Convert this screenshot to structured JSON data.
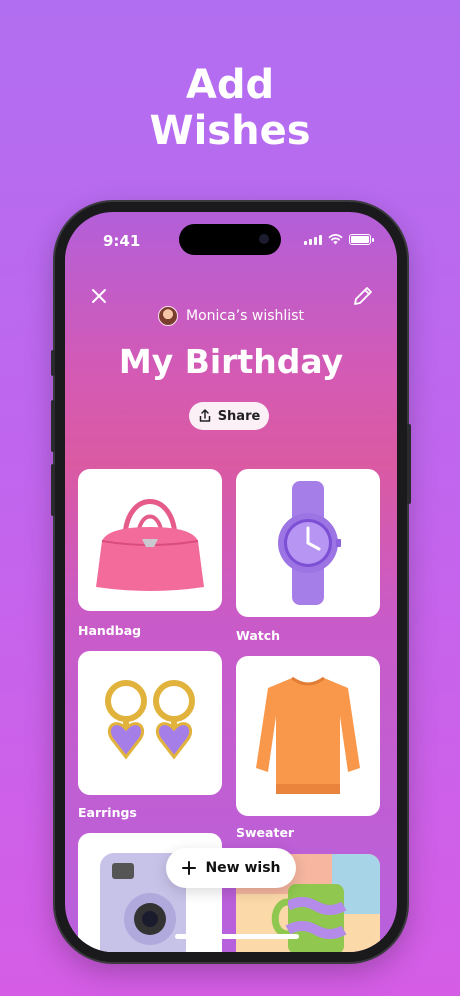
{
  "promo": {
    "headline": "Add\nWishes"
  },
  "status_bar": {
    "time": "9:41"
  },
  "header": {
    "owner": "Monica’s wishlist",
    "title": "My Birthday"
  },
  "share": {
    "label": "Share"
  },
  "items": [
    {
      "name": "Handbag"
    },
    {
      "name": "Watch"
    },
    {
      "name": "Earrings"
    },
    {
      "name": "Sweater"
    }
  ],
  "fab": {
    "label": "New wish"
  },
  "colors": {
    "accent": "#d55de6",
    "handbag": "#f36b9a",
    "lavender": "#a67ee8",
    "sweater": "#f9974a"
  }
}
